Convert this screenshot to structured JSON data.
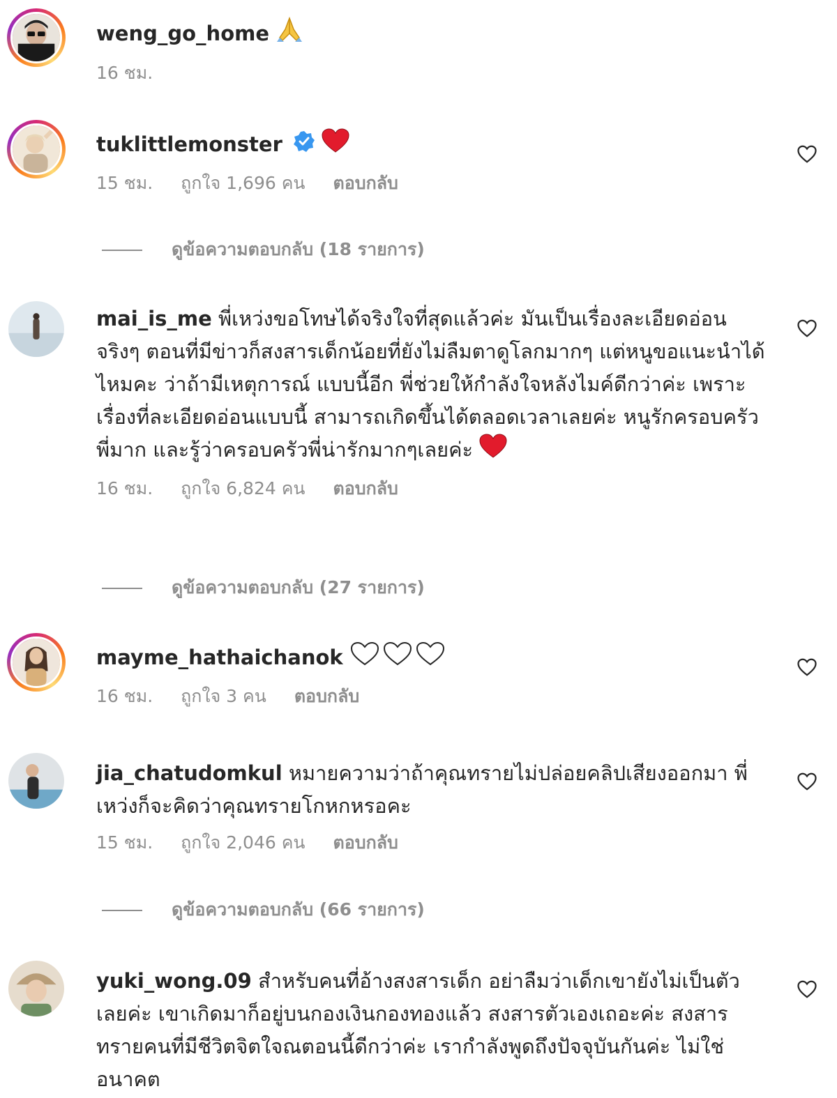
{
  "comments": [
    {
      "username": "weng_go_home",
      "text": "",
      "time": "16 ชม.",
      "likes": "",
      "reply": "",
      "trailing_emoji": "folded-hands"
    },
    {
      "username": "tuklittlemonster",
      "text": "",
      "time": "15 ชม.",
      "likes": "ถูกใจ 1,696 คน",
      "reply": "ตอบกลับ",
      "view_replies": "ดูข้อความตอบกลับ (18 รายการ)",
      "verified": true,
      "trailing_emoji": "red-heart"
    },
    {
      "username": "mai_is_me",
      "text": "พี่เหว่งขอโทษได้จริงใจที่สุดแล้วค่ะ มันเป็นเรื่องละเอียดอ่อนจริงๆ ตอนที่มีข่าวก็สงสารเด็กน้อยที่ยังไม่ลืมตาดูโลกมากๆ แต่หนูขอแนะนำได้ไหมคะ ว่าถ้ามีเหตุการณ์ แบบนี้อีก พี่ช่วยให้กำลังใจหลังไมค์ดีกว่าค่ะ เพราะเรื่องที่ละเอียดอ่อนแบบนี้ สามารถเกิดขึ้นได้ตลอดเวลาเลยค่ะ หนูรักครอบครัวพี่มาก และรู้ว่าครอบครัวพี่น่ารักมากๆเลยค่ะ",
      "time": "16 ชม.",
      "likes": "ถูกใจ 6,824 คน",
      "reply": "ตอบกลับ",
      "view_replies": "ดูข้อความตอบกลับ (27 รายการ)",
      "trailing_emoji": "red-heart"
    },
    {
      "username": "mayme_hathaichanok",
      "text": "",
      "time": "16 ชม.",
      "likes": "ถูกใจ 3 คน",
      "reply": "ตอบกลับ",
      "trailing_emoji": "three-white-hearts"
    },
    {
      "username": "jia_chatudomkul",
      "text": "หมายความว่าถ้าคุณทรายไม่ปล่อยคลิปเสียงออกมา พี่เหว่งก็จะคิดว่าคุณทรายโกหกหรอคะ",
      "time": "15 ชม.",
      "likes": "ถูกใจ 2,046 คน",
      "reply": "ตอบกลับ",
      "view_replies": "ดูข้อความตอบกลับ (66 รายการ)"
    },
    {
      "username": "yuki_wong.09",
      "text": "สำหรับคนที่อ้างสงสารเด็ก อย่าลืมว่าเด็กเขายังไม่เป็นตัวเลยค่ะ เขาเกิดมาก็อยู่บนกองเงินกองทองแล้ว สงสารตัวเองเถอะค่ะ สงสารทรายคนที่มีชีวิตจิตใจณตอนนี้ดีกว่าค่ะ เรากำลังพูดถึงปัจจุบันกันค่ะ ไม่ใช่อนาคต",
      "time": "",
      "likes": "",
      "reply": ""
    }
  ],
  "colors": {
    "text": "#262626",
    "meta": "#8e8e8e",
    "heart_red": "#ed4956",
    "verified_blue": "#3897f0"
  }
}
